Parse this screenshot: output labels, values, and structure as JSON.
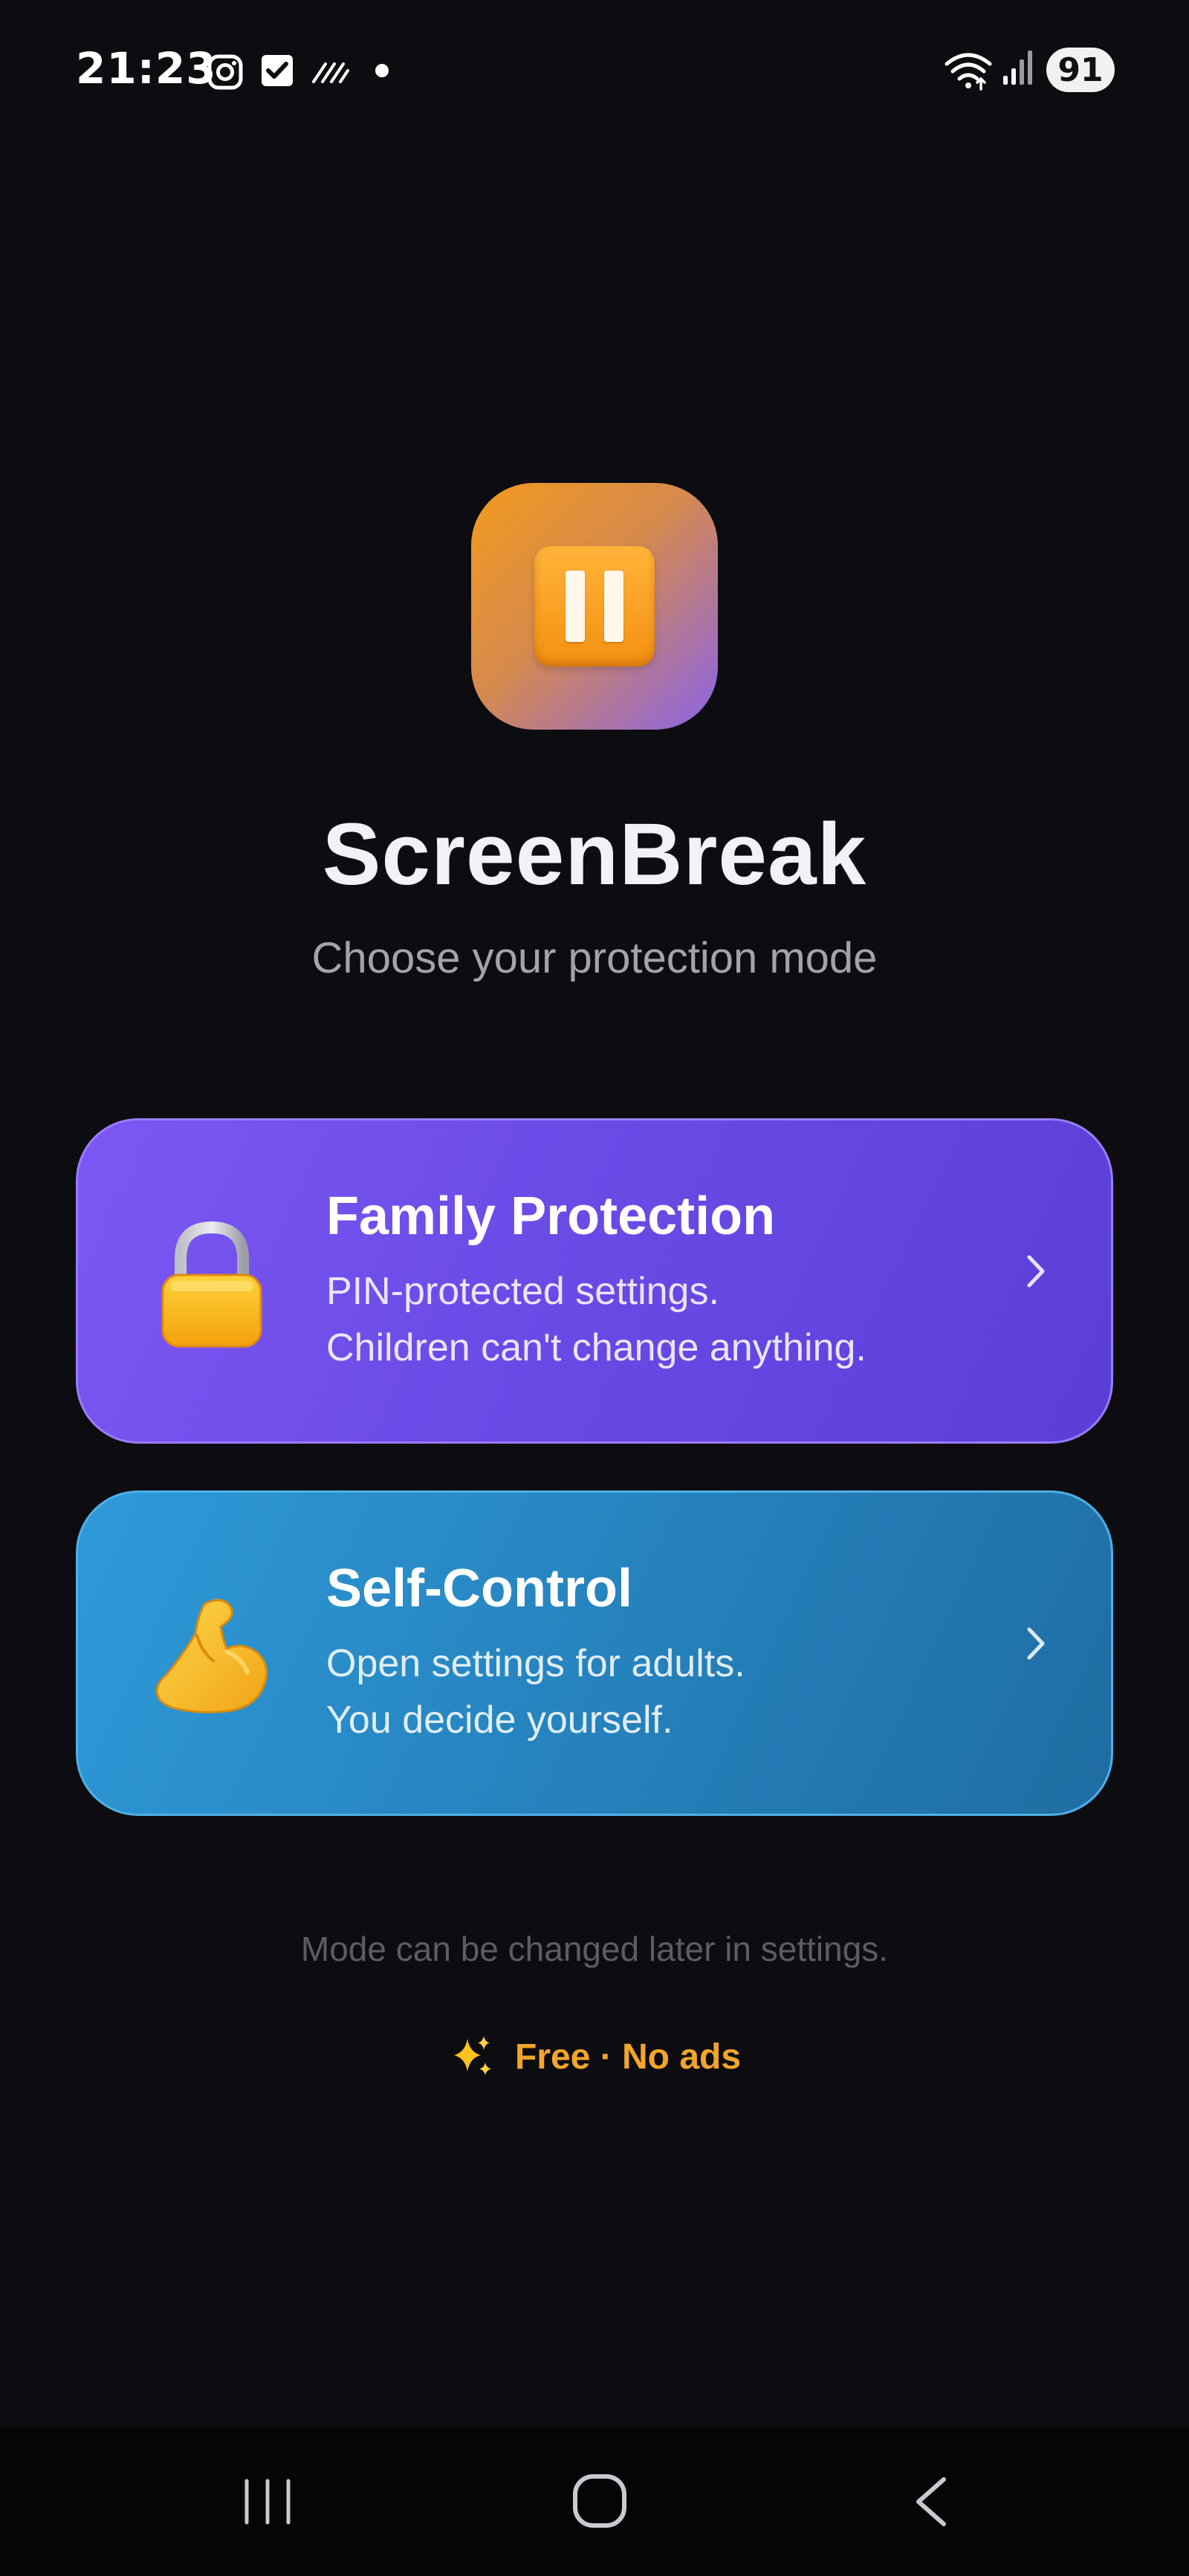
{
  "status_bar": {
    "time": "21:23",
    "battery": "91",
    "icons": [
      "instagram-icon",
      "checkbox-icon",
      "hatch-icon",
      "dot-icon",
      "wifi-icon",
      "signal-icon"
    ]
  },
  "app": {
    "icon": "pause-icon",
    "title": "ScreenBreak",
    "subtitle": "Choose your protection mode"
  },
  "modes": [
    {
      "icon": "lock-icon",
      "title": "Family Protection",
      "line1": "PIN-protected settings.",
      "line2": "Children can't change anything.",
      "color": "#6a4be6"
    },
    {
      "icon": "flexed-biceps-icon",
      "title": "Self-Control",
      "line1": "Open settings for adults.",
      "line2": "You decide yourself.",
      "color": "#2683be"
    }
  ],
  "footer": {
    "note": "Mode can be changed later in settings.",
    "free_text": "Free · No ads",
    "free_icon": "sparkles-icon",
    "accent": "#f2a52c"
  },
  "nav": {
    "items": [
      "recents-icon",
      "home-icon",
      "back-icon"
    ]
  }
}
